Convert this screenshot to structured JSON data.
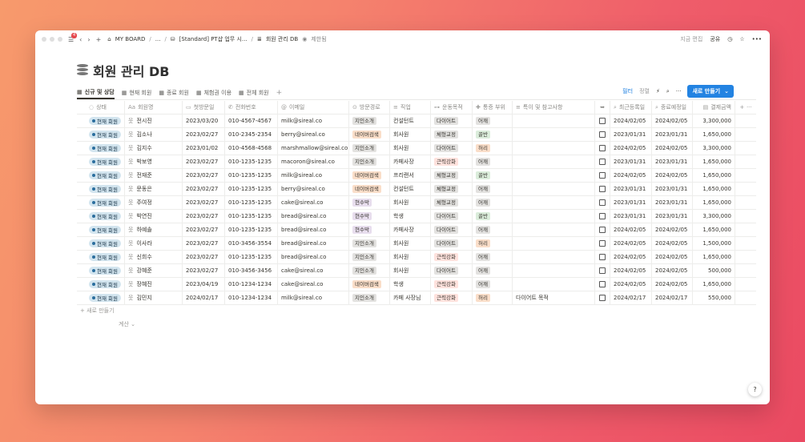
{
  "titlebar": {
    "menu_badge": "4",
    "board": "MY BOARD",
    "ellipsis": "...",
    "breadcrumb_1": "[Standard] PT샵 업무 시...",
    "breadcrumb_2": "회원 관리 DB",
    "shared": "제한됨",
    "edit_time": "지금 편집",
    "share": "공유"
  },
  "page": {
    "title": "회원 관리 DB"
  },
  "tabs": [
    {
      "label": "신규 및 상담",
      "active": true
    },
    {
      "label": "현재 회원"
    },
    {
      "label": "종료 회원"
    },
    {
      "label": "체험권 이용"
    },
    {
      "label": "전체 회원"
    }
  ],
  "toolbar": {
    "filter": "필터",
    "sort": "정렬",
    "new_label": "새로 만들기"
  },
  "columns": {
    "status": "상태",
    "name": "회원명",
    "first": "첫방문일",
    "phone": "전화번호",
    "email": "이메일",
    "route": "방문경로",
    "job": "직업",
    "goal": "운동목적",
    "part": "통증 부위",
    "note": "특이 및 참고사항",
    "last": "최근등록일",
    "end": "종료예정일",
    "pay": "결제금액"
  },
  "rows": [
    {
      "status": "현재 회원",
      "name": "전시진",
      "first": "2023/03/20",
      "phone": "010-4567-4567",
      "email": "milk@sireal.co",
      "route": "지인소개",
      "job": "컨설턴트",
      "goal": "다이어트",
      "part": "어깨",
      "note": "",
      "last": "2024/02/05",
      "end": "2024/02/05",
      "pay": "3,300,000"
    },
    {
      "status": "현재 회원",
      "name": "김소나",
      "first": "2023/02/27",
      "phone": "010-2345-2354",
      "email": "berry@sireal.co",
      "route": "네이버검색",
      "job": "회사원",
      "goal": "체형교정",
      "part": "골반",
      "note": "",
      "last": "2023/01/31",
      "end": "2023/01/31",
      "pay": "1,650,000"
    },
    {
      "status": "현재 회원",
      "name": "김지수",
      "first": "2023/01/02",
      "phone": "010-4568-4568",
      "email": "marshmallow@sireal.co",
      "route": "지인소개",
      "job": "회사원",
      "goal": "다이어트",
      "part": "허리",
      "note": "",
      "last": "2024/02/05",
      "end": "2024/02/05",
      "pay": "3,300,000"
    },
    {
      "status": "현재 회원",
      "name": "박보영",
      "first": "2023/02/27",
      "phone": "010-1235-1235",
      "email": "macoron@sireal.co",
      "route": "지인소개",
      "job": "카페사장",
      "goal": "근력강화",
      "part": "어깨",
      "note": "",
      "last": "2023/01/31",
      "end": "2023/01/31",
      "pay": "1,650,000"
    },
    {
      "status": "현재 회원",
      "name": "전재준",
      "first": "2023/02/27",
      "phone": "010-1235-1235",
      "email": "milk@sireal.co",
      "route": "네이버검색",
      "job": "프리랜서",
      "goal": "체형교정",
      "part": "골반",
      "note": "",
      "last": "2024/02/05",
      "end": "2024/02/05",
      "pay": "1,650,000"
    },
    {
      "status": "현재 회원",
      "name": "문동은",
      "first": "2023/02/27",
      "phone": "010-1235-1235",
      "email": "berry@sireal.co",
      "route": "네이버검색",
      "job": "컨설턴트",
      "goal": "체형교정",
      "part": "어깨",
      "note": "",
      "last": "2023/01/31",
      "end": "2023/01/31",
      "pay": "1,650,000"
    },
    {
      "status": "현재 회원",
      "name": "주여정",
      "first": "2023/02/27",
      "phone": "010-1235-1235",
      "email": "cake@sireal.co",
      "route": "현수막",
      "job": "회사원",
      "goal": "체형교정",
      "part": "어깨",
      "note": "",
      "last": "2023/01/31",
      "end": "2023/01/31",
      "pay": "1,650,000"
    },
    {
      "status": "현재 회원",
      "name": "박연진",
      "first": "2023/02/27",
      "phone": "010-1235-1235",
      "email": "bread@sireal.co",
      "route": "현수막",
      "job": "학생",
      "goal": "다이어트",
      "part": "골반",
      "note": "",
      "last": "2023/01/31",
      "end": "2023/01/31",
      "pay": "3,300,000"
    },
    {
      "status": "현재 회원",
      "name": "하예솔",
      "first": "2023/02/27",
      "phone": "010-1235-1235",
      "email": "bread@sireal.co",
      "route": "현수막",
      "job": "카페사장",
      "goal": "다이어트",
      "part": "어깨",
      "note": "",
      "last": "2024/02/05",
      "end": "2024/02/05",
      "pay": "1,650,000"
    },
    {
      "status": "현재 회원",
      "name": "이사라",
      "first": "2023/02/27",
      "phone": "010-3456-3554",
      "email": "bread@sireal.co",
      "route": "지인소개",
      "job": "회사원",
      "goal": "다이어트",
      "part": "허리",
      "note": "",
      "last": "2024/02/05",
      "end": "2024/02/05",
      "pay": "1,500,000"
    },
    {
      "status": "현재 회원",
      "name": "신희수",
      "first": "2023/02/27",
      "phone": "010-1235-1235",
      "email": "bread@sireal.co",
      "route": "지인소개",
      "job": "회사원",
      "goal": "근력강화",
      "part": "어깨",
      "note": "",
      "last": "2024/02/05",
      "end": "2024/02/05",
      "pay": "1,650,000"
    },
    {
      "status": "현재 회원",
      "name": "강혜준",
      "first": "2023/02/27",
      "phone": "010-3456-3456",
      "email": "cake@sireal.co",
      "route": "지인소개",
      "job": "회사원",
      "goal": "다이어트",
      "part": "어깨",
      "note": "",
      "last": "2024/02/05",
      "end": "2024/02/05",
      "pay": "500,000"
    },
    {
      "status": "현재 회원",
      "name": "장혜진",
      "first": "2023/04/19",
      "phone": "010-1234-1234",
      "email": "cake@sireal.co",
      "route": "네이버검색",
      "job": "학생",
      "goal": "근력강화",
      "part": "어깨",
      "note": "",
      "last": "2024/02/05",
      "end": "2024/02/05",
      "pay": "1,650,000"
    },
    {
      "status": "현재 회원",
      "name": "김민지",
      "first": "2024/02/17",
      "phone": "010-1234-1234",
      "email": "milk@sireal.co",
      "route": "지인소개",
      "job": "카페 사장님",
      "goal": "근력강화",
      "part": "허리",
      "note": "다이어트 목적",
      "last": "2024/02/17",
      "end": "2024/02/17",
      "pay": "550,000"
    }
  ],
  "tag_colors": {
    "지인소개": "#e3e2e0",
    "네이버검색": "#fadec9",
    "현수막": "#e8deee",
    "다이어트": "#e3e2e0",
    "체형교정": "#e3e2e0",
    "근력강화": "#ffe2dd",
    "어깨": "#e3e2e0",
    "골반": "#dbeddb",
    "허리": "#fadec9"
  },
  "footer": {
    "new_row": "+ 새로 만들기",
    "calc": "계산 ⌄"
  },
  "help": "?"
}
